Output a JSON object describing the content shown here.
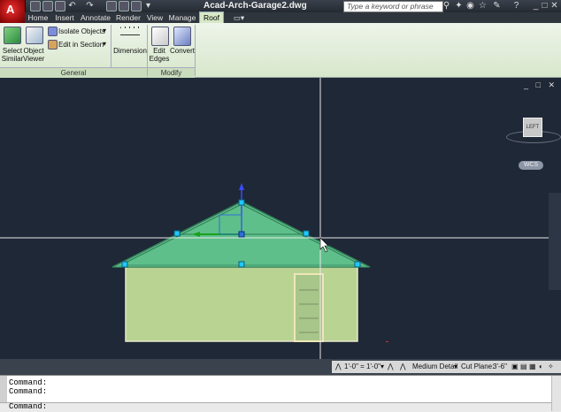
{
  "title_bar": {
    "app_initial": "A",
    "document_title": "Acad-Arch-Garage2.dwg",
    "search_placeholder": "Type a keyword or phrase"
  },
  "ribbon": {
    "tabs": [
      {
        "label": "Home",
        "active": false
      },
      {
        "label": "Insert",
        "active": false
      },
      {
        "label": "Annotate",
        "active": false
      },
      {
        "label": "Render",
        "active": false
      },
      {
        "label": "View",
        "active": false
      },
      {
        "label": "Manage",
        "active": false
      },
      {
        "label": "Roof",
        "active": true
      }
    ],
    "panels": {
      "general": {
        "title": "General",
        "select_similar": "Select Similar",
        "select_similar_l1": "Select",
        "select_similar_l2": "Similar",
        "object_viewer_l1": "Object",
        "object_viewer_l2": "Viewer",
        "isolate_objects": "Isolate Objects",
        "edit_in_section": "Edit in Section",
        "dimension": "Dimension"
      },
      "modify": {
        "title": "Modify",
        "edit_edges_l1": "Edit",
        "edit_edges_l2": "Edges",
        "convert": "Convert"
      }
    }
  },
  "viewport": {
    "viewcube_label": "LEFT",
    "wcs_label": "WCS",
    "colors": {
      "background": "#1f2836",
      "roof_fill": "#5fbf8a",
      "wall_fill": "#b9d393",
      "grip": "#1fc8ff",
      "crosshair": "#e8e8e8"
    }
  },
  "status_bar": {
    "scale": "1'-0\" = 1'-0\"",
    "detail_level": "Medium Detail",
    "cut_plane_label": "Cut Plane:",
    "cut_plane_value": "3'-6\""
  },
  "command_window": {
    "history": [
      "Command:",
      "Command:"
    ],
    "prompt": "Command:"
  }
}
